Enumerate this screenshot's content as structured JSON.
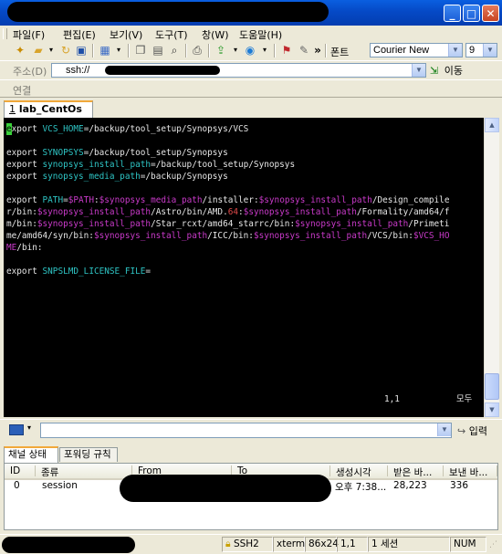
{
  "window": {
    "minimize": "_",
    "maximize": "□",
    "close": "✕"
  },
  "menu": [
    "파일(F)",
    "편집(E)",
    "보기(V)",
    "도구(T)",
    "창(W)",
    "도움말(H)"
  ],
  "toolbar": {
    "font_label": "폰트",
    "font_value": "Courier New",
    "size_value": "9",
    "more": "»"
  },
  "address": {
    "label": "주소(D)",
    "value": "ssh://",
    "go_label": "이동"
  },
  "connection": {
    "label": "연결"
  },
  "session_tab": {
    "number": "1",
    "name": "lab_CentOs"
  },
  "terminal": {
    "lines": [
      [
        {
          "t": "e",
          "c": "cursor"
        },
        {
          "t": "xport "
        },
        {
          "t": "VCS_HOME",
          "c": "c-var"
        },
        {
          "t": "=/backup/tool_setup/Synopsys/VCS"
        }
      ],
      [],
      [
        {
          "t": "export "
        },
        {
          "t": "SYNOPSYS",
          "c": "c-var"
        },
        {
          "t": "=/backup/tool_setup/Synopsys"
        }
      ],
      [
        {
          "t": "export "
        },
        {
          "t": "synopsys_install_path",
          "c": "c-var"
        },
        {
          "t": "=/backup/tool_setup/Synopsys"
        }
      ],
      [
        {
          "t": "export "
        },
        {
          "t": "synopsys_media_path",
          "c": "c-var"
        },
        {
          "t": "=/backup/Synopsys"
        }
      ],
      [],
      [
        {
          "t": "export "
        },
        {
          "t": "PATH",
          "c": "c-var"
        },
        {
          "t": "="
        },
        {
          "t": "$PATH",
          "c": "c-ref"
        },
        {
          "t": ":"
        },
        {
          "t": "$synopsys_media_path",
          "c": "c-ref"
        },
        {
          "t": "/installer:"
        },
        {
          "t": "$synopsys_install_path",
          "c": "c-ref"
        },
        {
          "t": "/Design_compile"
        }
      ],
      [
        {
          "t": "r/bin:"
        },
        {
          "t": "$synopsys_install_path",
          "c": "c-ref"
        },
        {
          "t": "/Astro/bin/AMD."
        },
        {
          "t": "64",
          "c": "c-num"
        },
        {
          "t": ":"
        },
        {
          "t": "$synopsys_install_path",
          "c": "c-ref"
        },
        {
          "t": "/Formality/amd64/f"
        }
      ],
      [
        {
          "t": "m/bin:"
        },
        {
          "t": "$synopsys_install_path",
          "c": "c-ref"
        },
        {
          "t": "/Star_rcxt/amd64_starrc/bin:"
        },
        {
          "t": "$synopsys_install_path",
          "c": "c-ref"
        },
        {
          "t": "/Primeti"
        }
      ],
      [
        {
          "t": "me/amd64/syn/bin:"
        },
        {
          "t": "$synopsys_install_path",
          "c": "c-ref"
        },
        {
          "t": "/ICC/bin:"
        },
        {
          "t": "$synopsys_install_path",
          "c": "c-ref"
        },
        {
          "t": "/VCS/bin:"
        },
        {
          "t": "$VCS_HO",
          "c": "c-ref"
        }
      ],
      [
        {
          "t": "ME",
          "c": "c-ref"
        },
        {
          "t": "/bin:"
        }
      ],
      [],
      [
        {
          "t": "export "
        },
        {
          "t": "SNPSLMD_LICENSE_FILE",
          "c": "c-var"
        },
        {
          "t": "="
        }
      ]
    ],
    "ruler": "1,1",
    "position": "모두"
  },
  "command": {
    "input_label": "입력"
  },
  "panel": {
    "tabs": [
      "채널 상태",
      "포워딩 규칙"
    ],
    "columns": [
      "ID",
      "종류",
      "From",
      "To",
      "생성시각",
      "받은 바...",
      "보낸 바..."
    ],
    "rows": [
      [
        "0",
        "session",
        "",
        "",
        "오후 7:38...",
        "28,223",
        "336"
      ]
    ]
  },
  "status": {
    "protocol": "SSH2",
    "term": "xterm",
    "size": "86x24",
    "cursor": "1,1",
    "sessions": "1 세션",
    "num": "NUM"
  }
}
